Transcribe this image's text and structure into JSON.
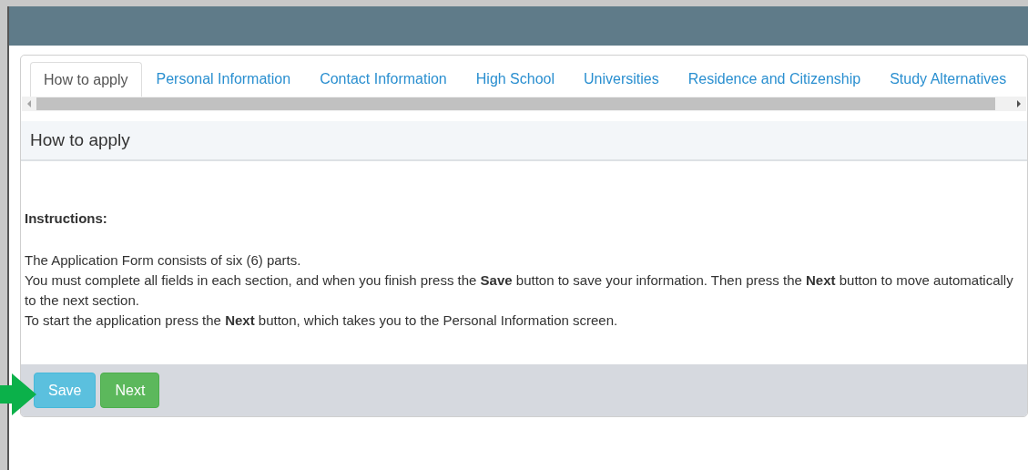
{
  "tabs": [
    {
      "label": "How to apply",
      "selected": true
    },
    {
      "label": "Personal Information",
      "selected": false
    },
    {
      "label": "Contact Information",
      "selected": false
    },
    {
      "label": "High School",
      "selected": false
    },
    {
      "label": "Universities",
      "selected": false
    },
    {
      "label": "Residence and Citizenship",
      "selected": false
    },
    {
      "label": "Study Alternatives",
      "selected": false
    }
  ],
  "section": {
    "title": "How to apply",
    "heading": "Instructions:",
    "paragraphs": [
      "The Application Form consists of six (6) parts.",
      "You must complete all fields in each section, and when you finish press the **Save** button to save your information. Then press the **Next** button to move automatically to the next section.",
      "To start the application press the **Next** button, which takes you to the Personal Information screen."
    ]
  },
  "buttons": [
    {
      "label": "Save",
      "kind": "info"
    },
    {
      "label": "Next",
      "kind": "success"
    }
  ]
}
